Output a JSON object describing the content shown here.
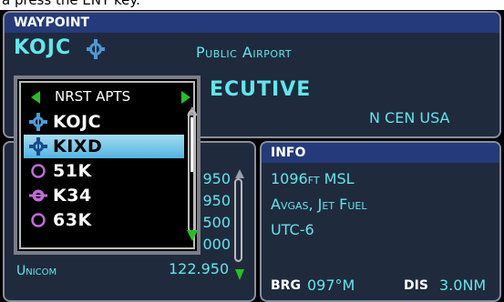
{
  "top_text": "a press the ENT key.",
  "waypoint": {
    "header": "WAYPOINT",
    "ident": "KOJC",
    "type": "Public Airport",
    "name_partial": "ECUTIVE",
    "region": "N CEN USA"
  },
  "nearest_popup": {
    "title": "NRST APTS",
    "items": [
      {
        "ident": "KOJC",
        "icon": "towered-airport-icon",
        "selected": false
      },
      {
        "ident": "KIXD",
        "icon": "towered-airport-icon",
        "selected": true
      },
      {
        "ident": "51K",
        "icon": "small-airport-icon",
        "selected": false
      },
      {
        "ident": "K34",
        "icon": "non-towered-airport-icon",
        "selected": false
      },
      {
        "ident": "63K",
        "icon": "small-airport-icon",
        "selected": false
      }
    ]
  },
  "frequencies": {
    "partial_values": [
      "950",
      "950",
      "500",
      "000"
    ],
    "unicom_label": "Unicom",
    "unicom_value": "122.950"
  },
  "info": {
    "header": "INFO",
    "elevation": "1096ft MSL",
    "fuel": "Avgas, Jet Fuel",
    "timezone": "UTC-6",
    "brg_label": "BRG",
    "brg_value": "097°M",
    "dis_label": "DIS",
    "dis_value": "3.0NM"
  },
  "colors": {
    "cyan_text": "#5fe8ea",
    "header_blue": "#243a7a",
    "panel_bg": "#1f2a3d",
    "selection": "#52b5e1",
    "magenta": "#c06ad8",
    "arrow_green": "#25c21e",
    "airport_blue": "#4a9ad6"
  }
}
